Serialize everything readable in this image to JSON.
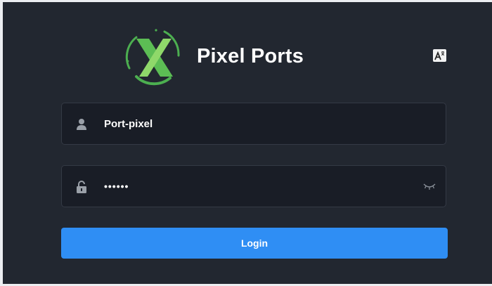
{
  "brand": {
    "name": "Pixel Ports",
    "logo_icon": "x-circle-logo",
    "logo_color": "#4caf50"
  },
  "language_button": {
    "icon": "translate-icon"
  },
  "username": {
    "icon": "user-icon",
    "value": "Port-pixel"
  },
  "password": {
    "icon": "lock-icon",
    "value": "••••••",
    "toggle_icon": "eye-closed-icon"
  },
  "login": {
    "label": "Login",
    "color": "#2f8ef4"
  },
  "colors": {
    "panel_bg": "#222730",
    "field_bg": "#191d26",
    "outer_bg": "#eceef1"
  }
}
